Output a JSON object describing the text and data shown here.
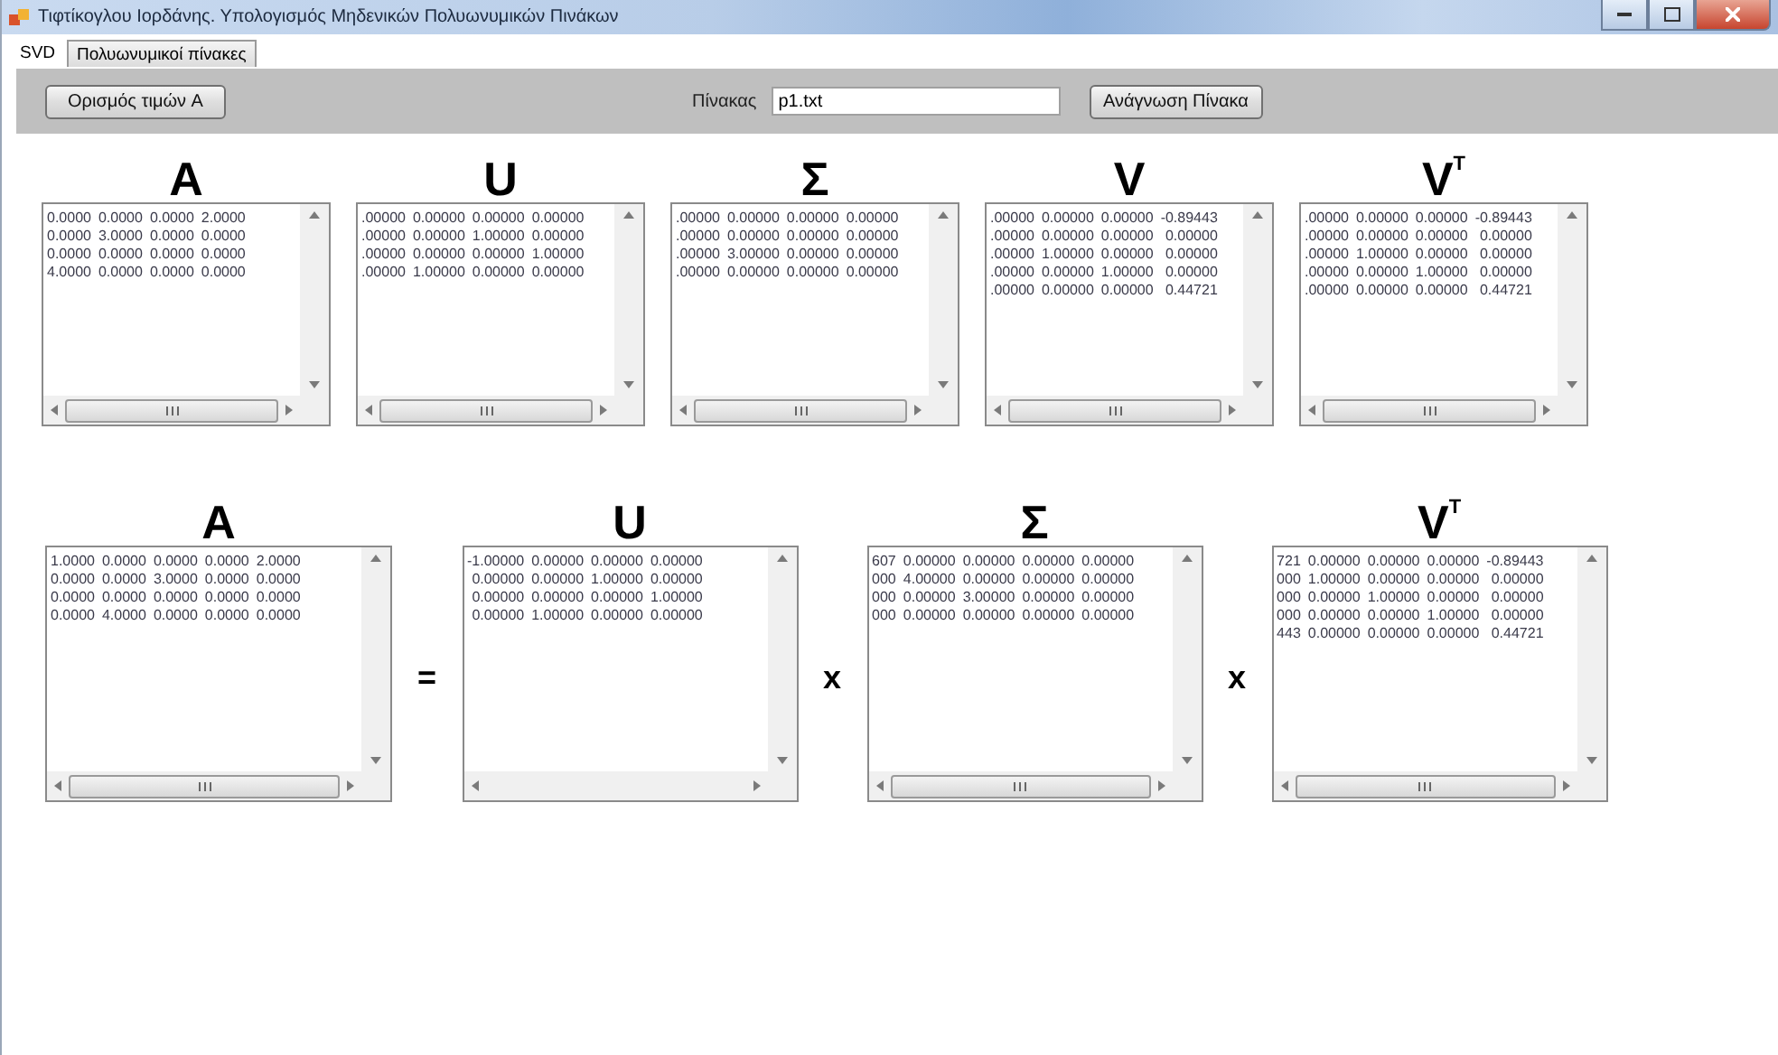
{
  "window": {
    "title": "Τιφτίκογλου Ιορδάνης. Υπολογισμός Μηδενικών Πολυωνυμικών Πινάκων"
  },
  "tabs": [
    {
      "label": "SVD",
      "selected": true
    },
    {
      "label": "Πολυωνυμικοί πίνακες",
      "selected": false
    }
  ],
  "toolbar": {
    "define_button": "Ορισμός τιμών A",
    "matrix_label": "Πίνακας",
    "file_field": {
      "value": "p1.txt"
    },
    "read_button": "Ανάγνωση Πίνακα"
  },
  "top_matrices": [
    {
      "heading": "A",
      "scroll_thumb": true,
      "rows": [
        [
          "0.0000",
          "0.0000",
          "0.0000",
          "2.0000"
        ],
        [
          "0.0000",
          "3.0000",
          "0.0000",
          "0.0000"
        ],
        [
          "0.0000",
          "0.0000",
          "0.0000",
          "0.0000"
        ],
        [
          "4.0000",
          "0.0000",
          "0.0000",
          "0.0000"
        ]
      ]
    },
    {
      "heading": "U",
      "scroll_thumb": true,
      "rows": [
        [
          ".00000",
          "0.00000",
          "0.00000",
          "0.00000"
        ],
        [
          ".00000",
          "0.00000",
          "1.00000",
          "0.00000"
        ],
        [
          ".00000",
          "0.00000",
          "0.00000",
          "1.00000"
        ],
        [
          ".00000",
          "1.00000",
          "0.00000",
          "0.00000"
        ]
      ]
    },
    {
      "heading": "Σ",
      "scroll_thumb": true,
      "rows": [
        [
          ".00000",
          "0.00000",
          "0.00000",
          "0.00000"
        ],
        [
          ".00000",
          "0.00000",
          "0.00000",
          "0.00000"
        ],
        [
          ".00000",
          "3.00000",
          "0.00000",
          "0.00000"
        ],
        [
          ".00000",
          "0.00000",
          "0.00000",
          "0.00000"
        ]
      ]
    },
    {
      "heading": "V",
      "scroll_thumb": true,
      "rows": [
        [
          ".00000",
          "0.00000",
          "0.00000",
          "-0.89443"
        ],
        [
          ".00000",
          "0.00000",
          "0.00000",
          "0.00000"
        ],
        [
          ".00000",
          "1.00000",
          "0.00000",
          "0.00000"
        ],
        [
          ".00000",
          "0.00000",
          "1.00000",
          "0.00000"
        ],
        [
          ".00000",
          "0.00000",
          "0.00000",
          "0.44721"
        ]
      ]
    },
    {
      "heading": "V$^{T}$",
      "scroll_thumb": true,
      "rows": [
        [
          ".00000",
          "0.00000",
          "0.00000",
          "-0.89443"
        ],
        [
          ".00000",
          "0.00000",
          "0.00000",
          "0.00000"
        ],
        [
          ".00000",
          "1.00000",
          "0.00000",
          "0.00000"
        ],
        [
          ".00000",
          "0.00000",
          "1.00000",
          "0.00000"
        ],
        [
          ".00000",
          "0.00000",
          "0.00000",
          "0.44721"
        ]
      ]
    }
  ],
  "equation": [
    {
      "kind": "matrix",
      "heading": "A",
      "scroll_thumb": true,
      "rows": [
        [
          "1.0000",
          "0.0000",
          "0.0000",
          "0.0000",
          "2.0000"
        ],
        [
          "0.0000",
          "0.0000",
          "3.0000",
          "0.0000",
          "0.0000"
        ],
        [
          "0.0000",
          "0.0000",
          "0.0000",
          "0.0000",
          "0.0000"
        ],
        [
          "0.0000",
          "4.0000",
          "0.0000",
          "0.0000",
          "0.0000"
        ]
      ]
    },
    {
      "kind": "operator",
      "symbol": "="
    },
    {
      "kind": "matrix",
      "heading": "U",
      "scroll_thumb": false,
      "rows": [
        [
          "-1.00000",
          "0.00000",
          "0.00000",
          "0.00000"
        ],
        [
          "0.00000",
          "0.00000",
          "1.00000",
          "0.00000"
        ],
        [
          "0.00000",
          "0.00000",
          "0.00000",
          "1.00000"
        ],
        [
          "0.00000",
          "1.00000",
          "0.00000",
          "0.00000"
        ]
      ]
    },
    {
      "kind": "operator",
      "symbol": "x"
    },
    {
      "kind": "matrix",
      "heading": "Σ",
      "scroll_thumb": true,
      "rows": [
        [
          "607",
          "0.00000",
          "0.00000",
          "0.00000",
          "0.00000"
        ],
        [
          "000",
          "4.00000",
          "0.00000",
          "0.00000",
          "0.00000"
        ],
        [
          "000",
          "0.00000",
          "3.00000",
          "0.00000",
          "0.00000"
        ],
        [
          "000",
          "0.00000",
          "0.00000",
          "0.00000",
          "0.00000"
        ]
      ]
    },
    {
      "kind": "operator",
      "symbol": "x"
    },
    {
      "kind": "matrix",
      "heading": "V$^{T}$",
      "scroll_thumb": true,
      "rows": [
        [
          "721",
          "0.00000",
          "0.00000",
          "0.00000",
          "-0.89443"
        ],
        [
          "000",
          "1.00000",
          "0.00000",
          "0.00000",
          "0.00000"
        ],
        [
          "000",
          "0.00000",
          "1.00000",
          "0.00000",
          "0.00000"
        ],
        [
          "000",
          "0.00000",
          "0.00000",
          "1.00000",
          "0.00000"
        ],
        [
          "443",
          "0.00000",
          "0.00000",
          "0.00000",
          "0.44721"
        ]
      ]
    }
  ]
}
